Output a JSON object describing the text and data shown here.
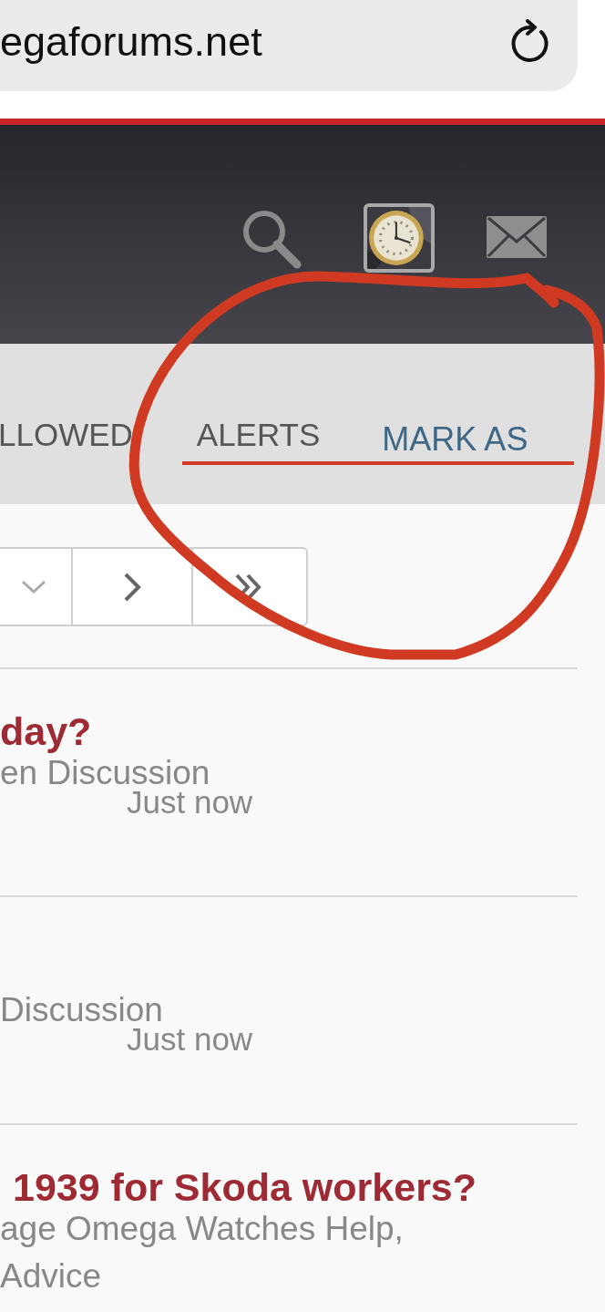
{
  "browser": {
    "url": "egaforums.net"
  },
  "nav": {
    "items": [
      {
        "label": "LLOWED",
        "kind": "tab"
      },
      {
        "label": "ALERTS",
        "kind": "tab"
      },
      {
        "label": "MARK AS",
        "kind": "link"
      }
    ]
  },
  "threads": [
    {
      "title": "day?",
      "forum": "en Discussion",
      "time": "Just now"
    },
    {
      "forum": "Discussion",
      "time": "Just now"
    },
    {
      "title": "1939 for Skoda workers?",
      "forum": "age Omega Watches Help,\nAdvice"
    }
  ]
}
